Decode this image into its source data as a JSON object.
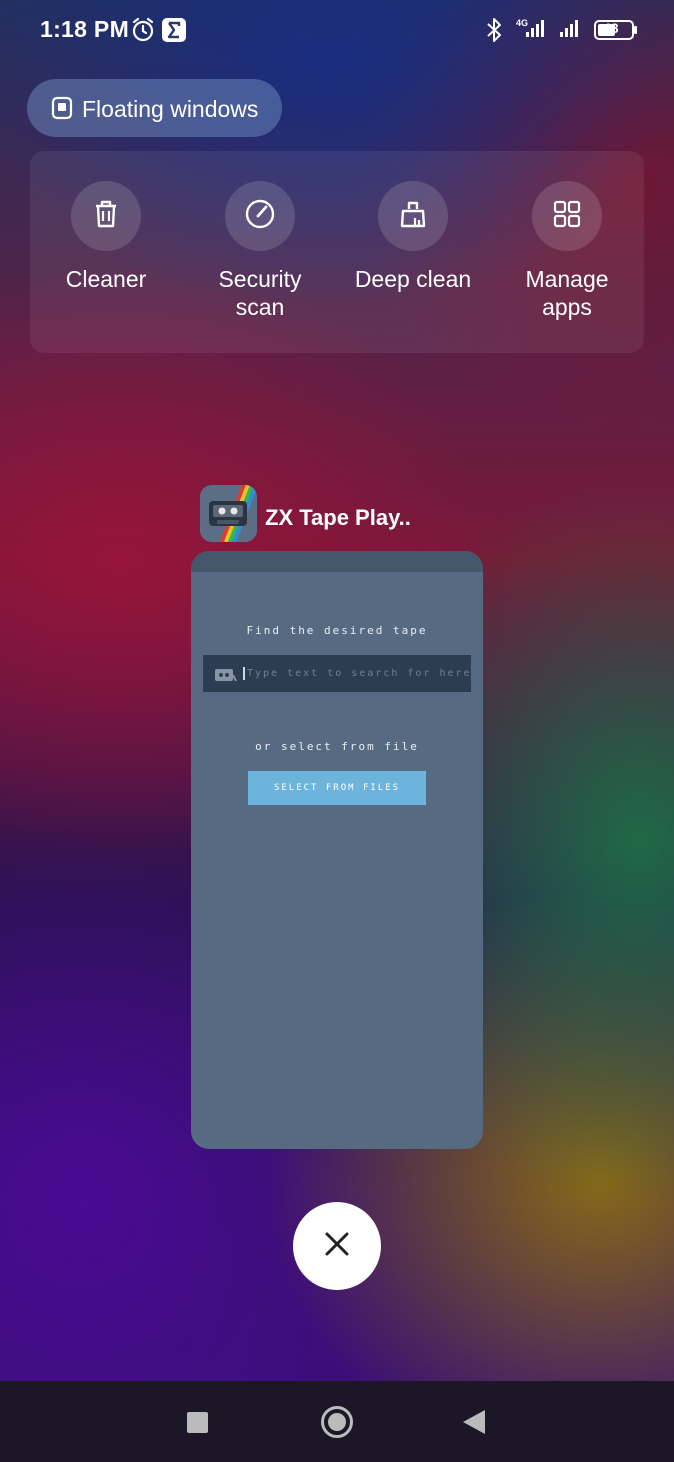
{
  "status_bar": {
    "time": "1:18 PM",
    "icons": [
      "alarm-icon",
      "sigma-notification-icon",
      "bluetooth-icon",
      "signal-4g-icon",
      "signal-icon",
      "battery-icon"
    ],
    "network_label": "4G",
    "battery_level": "48"
  },
  "floating_windows": {
    "label": "Floating windows",
    "icon": "floating-window-icon"
  },
  "quick_actions": [
    {
      "label": "Cleaner",
      "icon": "trash-icon"
    },
    {
      "label": "Security\nscan",
      "icon": "security-gauge-icon"
    },
    {
      "label": "Deep clean",
      "icon": "deep-clean-icon"
    },
    {
      "label": "Manage\napps",
      "icon": "grid-icon"
    }
  ],
  "app_card": {
    "title": "ZX Tape Play..",
    "icon": "zx-tape-cassette-icon",
    "find_text": "Find the desired tape",
    "search_placeholder": "Type text to search for here",
    "or_text": "or select from file",
    "select_button": "SELECT FROM FILES"
  },
  "close_button": {
    "icon": "close-icon"
  },
  "nav_bar": {
    "icons": [
      "recents-icon",
      "home-icon",
      "back-icon"
    ]
  },
  "colors": {
    "card_bg": "#566b81",
    "search_bg": "#2c3d52",
    "button_bg": "#6cb4dc",
    "nav_bg": "#1b1726"
  }
}
